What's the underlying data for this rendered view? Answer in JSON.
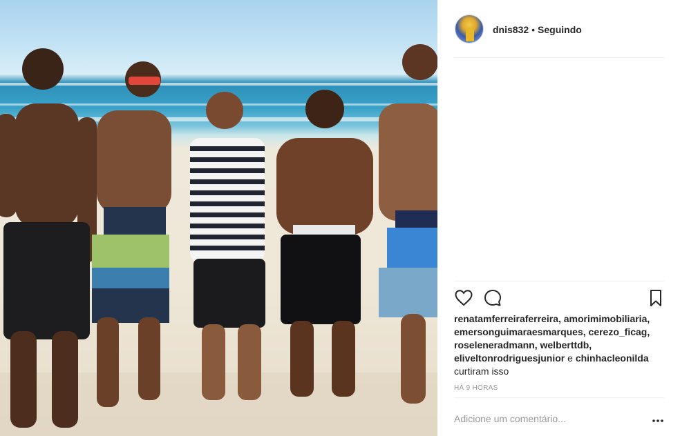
{
  "post": {
    "username": "dnis832",
    "separator": "•",
    "follow_status": "Seguindo",
    "likes": {
      "users": [
        "renatamferreiraferreira,",
        "amorimimobiliaria,",
        "emersonguimaraesmarques,",
        "cerezo_ficag,",
        "roseleneradmann,",
        "welberttdb,",
        "eliveltonrodriguesjunior"
      ],
      "conjunction": "e",
      "last_user": "chinhacleonilda",
      "suffix": "curtiram isso"
    },
    "timestamp": "HÁ 9 HORAS",
    "comment_placeholder": "Adicione um comentário...",
    "more_glyph": "•••"
  },
  "icons": {
    "like": "heart-icon",
    "comment": "speech-bubble-icon",
    "save": "bookmark-icon",
    "more": "ellipsis-icon"
  },
  "colors": {
    "text": "#262626",
    "muted": "#999999",
    "divider": "#efefef"
  }
}
